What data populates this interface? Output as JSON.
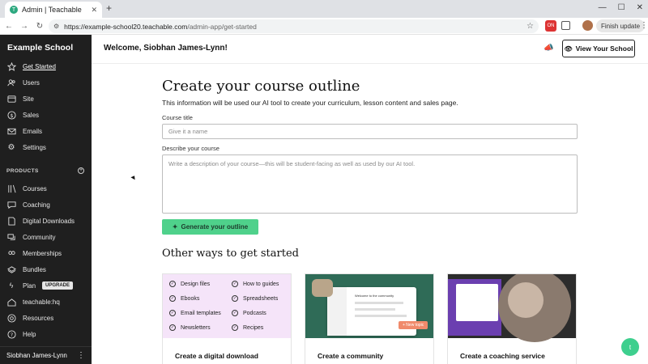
{
  "browser": {
    "tab_title": "Admin | Teachable",
    "tab_favicon": "T",
    "url_host": "https://example-school20.teachable.com",
    "url_path": "/admin-app/get-started",
    "finish_update": "Finish update",
    "ext_badge": "ON"
  },
  "sidebar": {
    "school_name": "Example School",
    "items": [
      {
        "label": "Get Started",
        "icon": "star-icon"
      },
      {
        "label": "Users",
        "icon": "users-icon"
      },
      {
        "label": "Site",
        "icon": "site-icon"
      },
      {
        "label": "Sales",
        "icon": "dollar-icon"
      },
      {
        "label": "Emails",
        "icon": "mail-icon"
      },
      {
        "label": "Settings",
        "icon": "gear-icon"
      }
    ],
    "products_label": "PRODUCTS",
    "products": [
      {
        "label": "Courses",
        "icon": "courses-icon"
      },
      {
        "label": "Coaching",
        "icon": "coaching-icon"
      },
      {
        "label": "Digital Downloads",
        "icon": "download-icon"
      },
      {
        "label": "Community",
        "icon": "community-icon"
      },
      {
        "label": "Memberships",
        "icon": "membership-icon"
      },
      {
        "label": "Bundles",
        "icon": "bundle-icon"
      }
    ],
    "plan_label": "Plan",
    "upgrade_label": "UPGRADE",
    "extra": [
      {
        "label": "teachable:hq",
        "icon": "hq-icon"
      },
      {
        "label": "Resources",
        "icon": "resources-icon"
      },
      {
        "label": "Help",
        "icon": "help-icon"
      }
    ],
    "user_name": "Siobhan James-Lynn"
  },
  "header": {
    "welcome": "Welcome, Siobhan James-Lynn!",
    "view_school": "View Your School"
  },
  "main": {
    "title": "Create your course outline",
    "subtitle": "This information will be used our AI tool to create your curriculum, lesson content and sales page.",
    "course_title_label": "Course title",
    "course_title_placeholder": "Give it a name",
    "describe_label": "Describe your course",
    "describe_placeholder": "Write a description of your course—this will be student-facing as well as used by our AI tool.",
    "generate_button": "Generate your outline",
    "other_ways_title": "Other ways to get started",
    "card1_features": [
      "Design files",
      "How to guides",
      "Ebooks",
      "Spreadsheets",
      "Email templates",
      "Podcasts",
      "Newsletters",
      "Recipes"
    ],
    "card1_title": "Create a digital download",
    "card2_title": "Create a community",
    "card2_snippet": "Welcome to the community",
    "card2_button": "+ New topic",
    "card3_title": "Create a coaching service"
  },
  "fab_label": "t",
  "colors": {
    "accent": "#4fd18b",
    "sidebar_bg": "#1f1f1f",
    "card1_bg": "#f5e4f9",
    "card2_bg": "#2f6b57"
  }
}
